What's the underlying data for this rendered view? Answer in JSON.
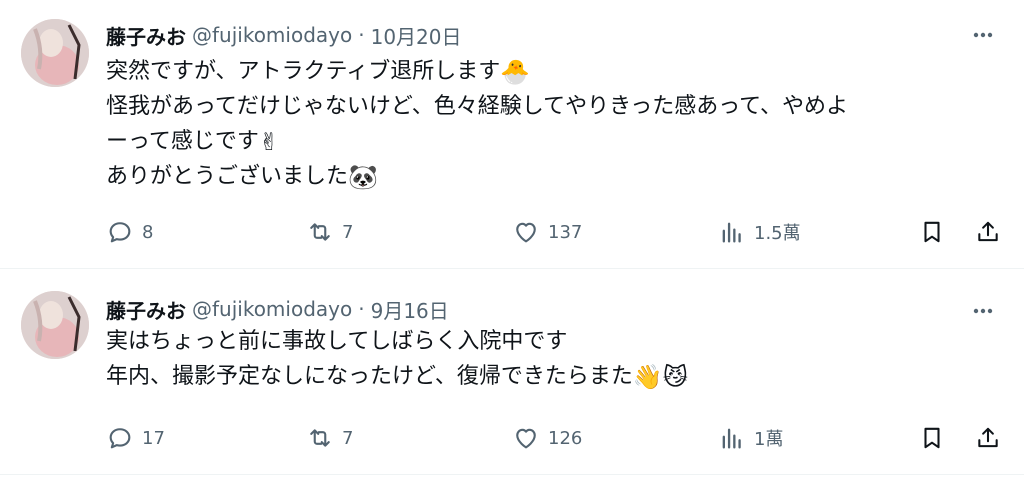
{
  "tweets": [
    {
      "author_name": "藤子みお",
      "handle": "@fujikomiodayo",
      "separator": "·",
      "date": "10月20日",
      "lines": [
        {
          "text": "突然ですが、アトラクティブ退所します",
          "emoji": "🐣"
        },
        {
          "text": "怪我があってだけじゃないけど、色々経験してやりきった感あって、やめよ",
          "emoji": ""
        },
        {
          "text": "ーって感じです",
          "emoji": "✌"
        },
        {
          "text": "ありがとうございました",
          "emoji": "🐼"
        }
      ],
      "counts": {
        "replies": "8",
        "retweets": "7",
        "likes": "137",
        "views": "1.5萬"
      }
    },
    {
      "author_name": "藤子みお",
      "handle": "@fujikomiodayo",
      "separator": "·",
      "date": "9月16日",
      "lines": [
        {
          "text": "実はちょっと前に事故してしばらく入院中です",
          "emoji": ""
        },
        {
          "text": "年内、撮影予定なしになったけど、復帰できたらまた",
          "emoji": "👋😼"
        }
      ],
      "counts": {
        "replies": "17",
        "retweets": "7",
        "likes": "126",
        "views": "1萬"
      }
    }
  ],
  "icons": {
    "more": "more-horizontal-icon",
    "reply": "reply-icon",
    "retweet": "retweet-icon",
    "like": "heart-icon",
    "views": "views-chart-icon",
    "bookmark": "bookmark-icon",
    "share": "share-icon"
  },
  "colors": {
    "text": "#0f1419",
    "secondary": "#536471",
    "divider": "#eff3f4"
  }
}
